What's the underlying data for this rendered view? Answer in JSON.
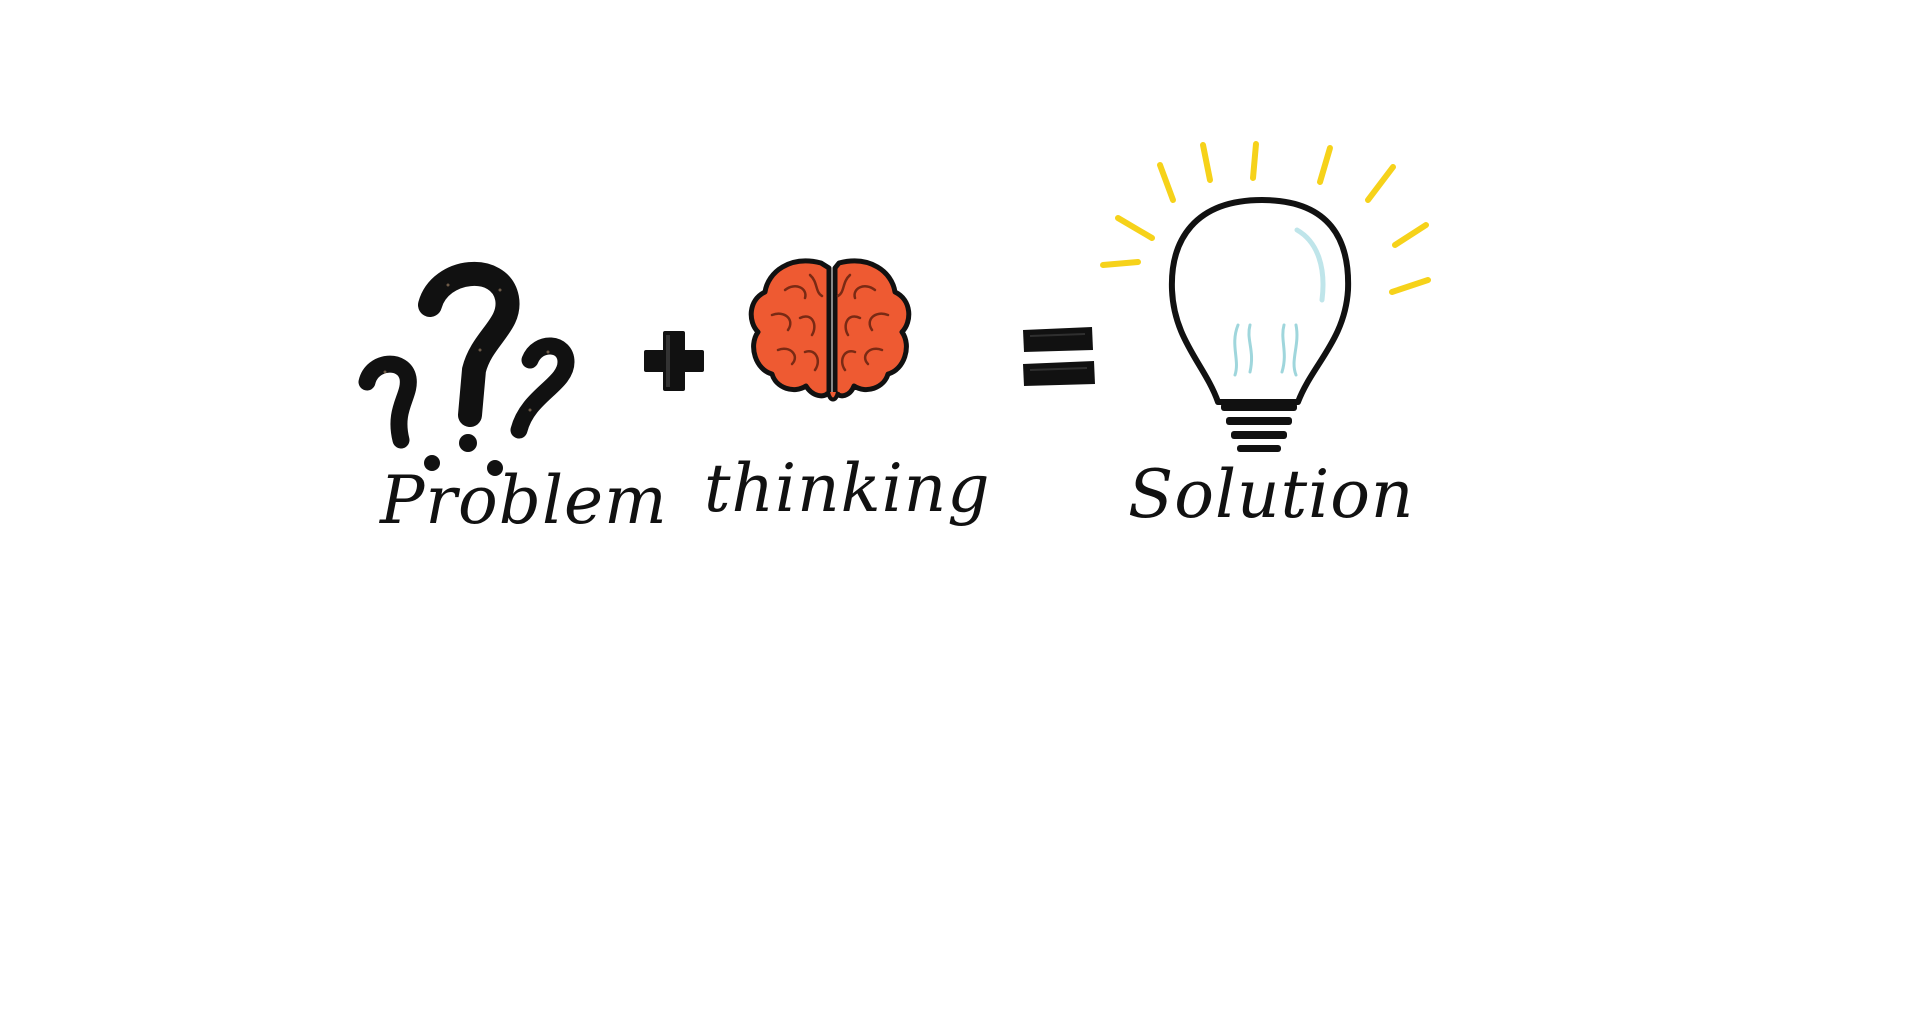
{
  "equation": {
    "term_problem": "Problem",
    "term_thinking": "thinking",
    "term_solution": "Solution",
    "operator_plus": "+",
    "operator_equals": "="
  },
  "icons": {
    "problem": "question-marks-icon",
    "thinking": "brain-icon",
    "solution": "light-bulb-icon"
  },
  "colors": {
    "ink": "#111111",
    "brain": "#ee5a32",
    "rays": "#f6d21a",
    "bulb_glass": "#e6f6f8"
  }
}
